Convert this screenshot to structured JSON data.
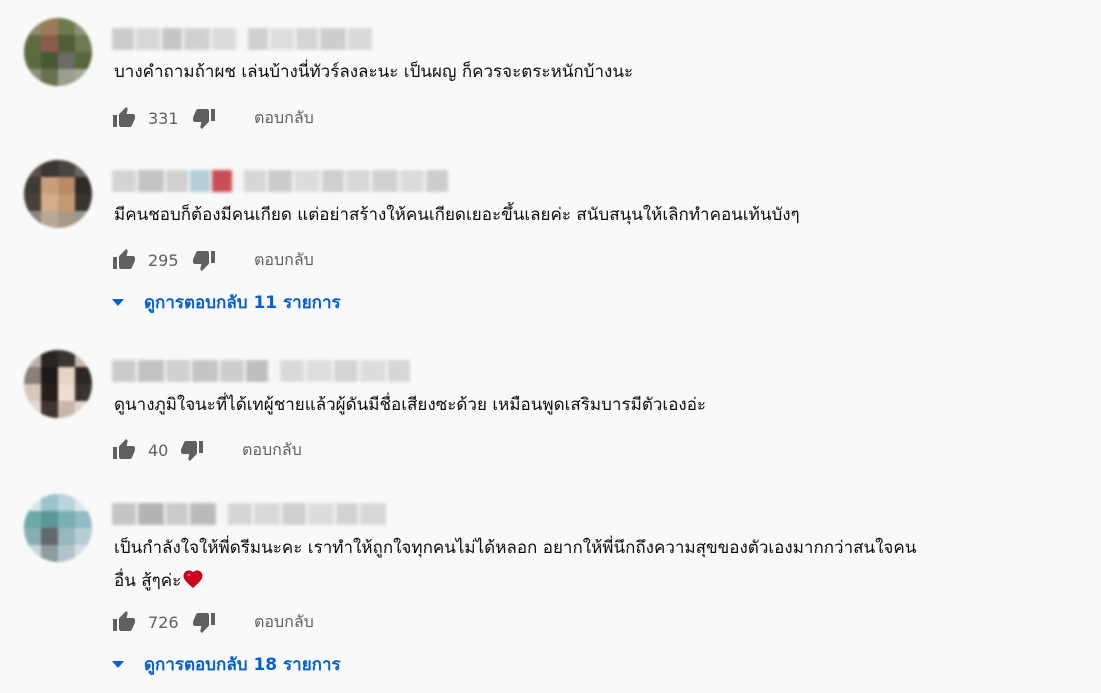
{
  "comments": [
    {
      "author": "",
      "text": "บางคำถามถ้าผช เล่นบ้างนี่ทัวร์ลงละนะ เป็นผญ ก็ควรจะตระหนักบ้างนะ",
      "likes": "331",
      "reply_label": "ตอบกลับ",
      "view_replies": ""
    },
    {
      "author": "",
      "text": "มีคนชอบก็ต้องมีคนเกียด แต่อย่าสร้างให้คนเกียดเยอะขึ้นเลยค่ะ สนับสนุนให้เลิกทำคอนเท้นบังๆ",
      "likes": "295",
      "reply_label": "ตอบกลับ",
      "view_replies": "ดูการตอบกลับ 11 รายการ"
    },
    {
      "author": "",
      "text": "ดูนางภูมิใจนะที่ได้เทผู้ชายแล้วผู้ดันมีชื่อเสียงซะด้วย เหมือนพูดเสริมบารมีตัวเองอ่ะ",
      "likes": "40",
      "reply_label": "ตอบกลับ",
      "view_replies": ""
    },
    {
      "author": "",
      "text_line1": "เป็นกำลังใจให้พี่ดรีมนะคะ เราทำให้ถูกใจทุกคนไม่ได้หลอก อยากให้พี่นึกถึงความสุขของตัวเองมากกว่าสนใจคน",
      "text_line2": "อื่น สู้ๆค่ะ",
      "likes": "726",
      "reply_label": "ตอบกลับ",
      "view_replies": "ดูการตอบกลับ 18 รายการ"
    }
  ],
  "icons": {
    "like": "thumb-up-icon",
    "dislike": "thumb-down-icon",
    "expand": "caret-down-icon",
    "emoji": "red-heart-emoji"
  },
  "colors": {
    "link": "#065fd4",
    "secondary_text": "#606060",
    "background": "#f9f9f9",
    "heart": "#d0021b"
  }
}
